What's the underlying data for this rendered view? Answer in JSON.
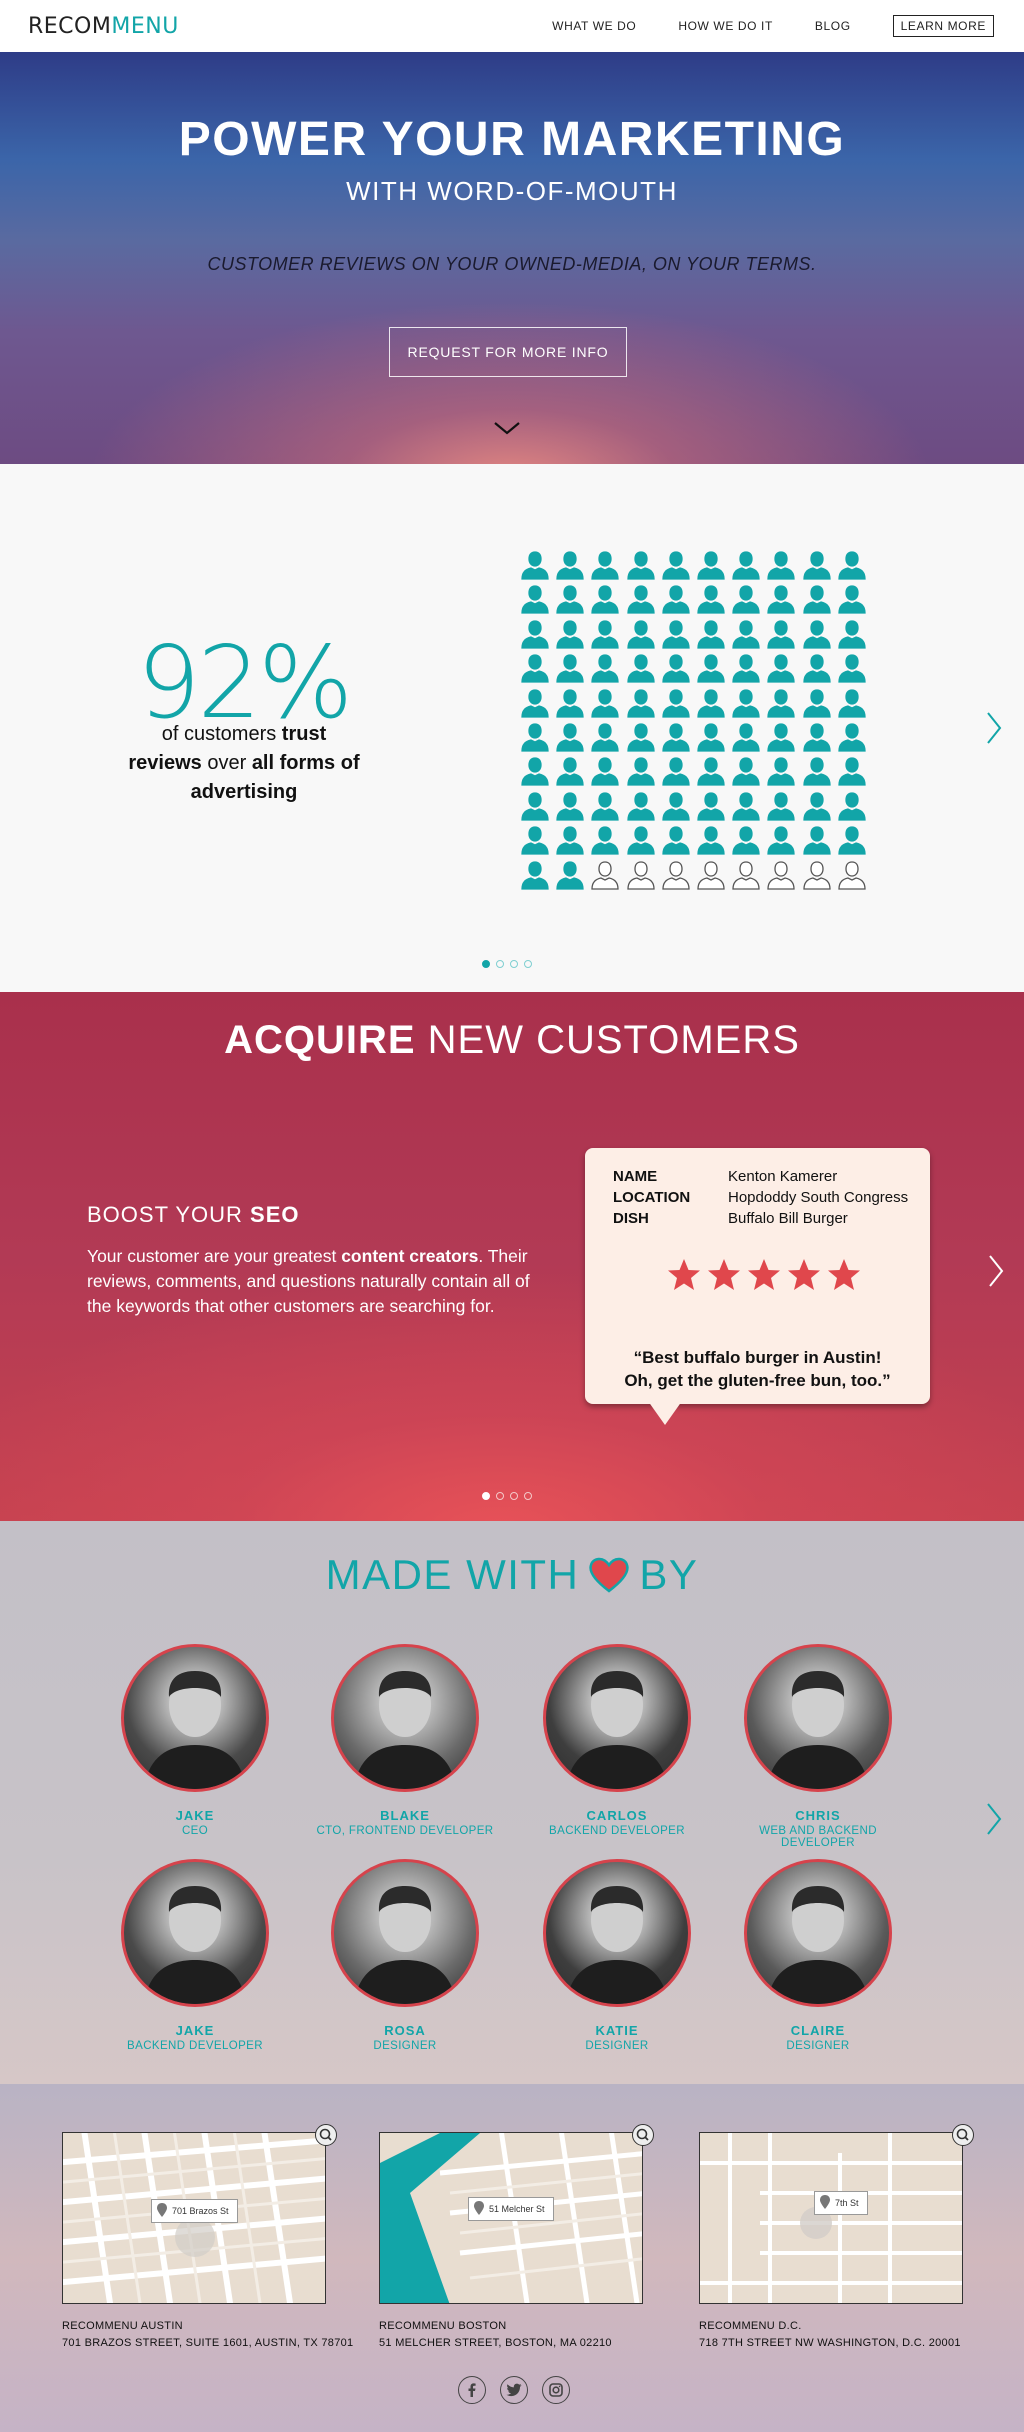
{
  "nav": {
    "logo_part1": "RECOM",
    "logo_part2": "MENU",
    "links": [
      "WHAT WE DO",
      "HOW WE DO IT",
      "BLOG"
    ],
    "cta": "LEARN MORE"
  },
  "hero": {
    "title": "POWER YOUR MARKETING",
    "subtitle": "WITH WORD-OF-MOUTH",
    "tagline": "CUSTOMER REVIEWS ON YOUR OWNED-MEDIA, ON YOUR TERMS.",
    "button": "REQUEST FOR MORE INFO"
  },
  "stats": {
    "percent": "92%",
    "text_1": "of customers ",
    "text_bold_1": "trust reviews",
    "text_2": " over ",
    "text_bold_2": "all forms of advertising",
    "filled_people": 92,
    "total_people": 100,
    "active_dot": 0,
    "dot_count": 4
  },
  "acquire": {
    "title_bold": "ACQUIRE",
    "title_rest": " NEW CUSTOMERS",
    "seo_prefix": "BOOST YOUR ",
    "seo_bold": "SEO",
    "text_1": "Your customer are your greatest ",
    "text_bold": "content creators",
    "text_2": ". Their reviews, comments, and questions naturally contain all of the keywords that other customers are searching for.",
    "review": {
      "name_label": "NAME",
      "name": "Kenton Kamerer",
      "location_label": "LOCATION",
      "location": "Hopdoddy South Congress",
      "dish_label": "DISH",
      "dish": "Buffalo Bill Burger",
      "stars": 5,
      "quote_line1": "“Best buffalo burger in Austin!",
      "quote_line2": "Oh, get the gluten-free bun, too.”"
    },
    "active_dot": 0,
    "dot_count": 4
  },
  "team": {
    "title_1": "MADE WITH",
    "title_2": "BY",
    "members": [
      {
        "name": "JAKE",
        "role": "CEO"
      },
      {
        "name": "BLAKE",
        "role": "CTO, FRONTEND DEVELOPER"
      },
      {
        "name": "CARLOS",
        "role": "BACKEND DEVELOPER"
      },
      {
        "name": "CHRIS",
        "role": "WEB AND BACKEND DEVELOPER"
      },
      {
        "name": "JAKE",
        "role": "BACKEND DEVELOPER"
      },
      {
        "name": "ROSA",
        "role": "DESIGNER"
      },
      {
        "name": "KATIE",
        "role": "DESIGNER"
      },
      {
        "name": "CLAIRE",
        "role": "DESIGNER"
      }
    ]
  },
  "offices": [
    {
      "name": "RECOMMENU AUSTIN",
      "address": "701 BRAZOS STREET, SUITE 1601, AUSTIN, TX 78701",
      "map_label": "701 Brazos St"
    },
    {
      "name": "RECOMMENU BOSTON",
      "address": "51 MELCHER STREET, BOSTON, MA 02210",
      "map_label": "51 Melcher St"
    },
    {
      "name": "RECOMMENU D.C.",
      "address": "718 7TH STREET NW WASHINGTON, D.C. 20001",
      "map_label": "7th St"
    }
  ],
  "socials": [
    "facebook-icon",
    "twitter-icon",
    "instagram-icon"
  ],
  "colors": {
    "teal": "#12a5a8",
    "coral_red": "#d6434c",
    "star_red": "#e0474c"
  }
}
